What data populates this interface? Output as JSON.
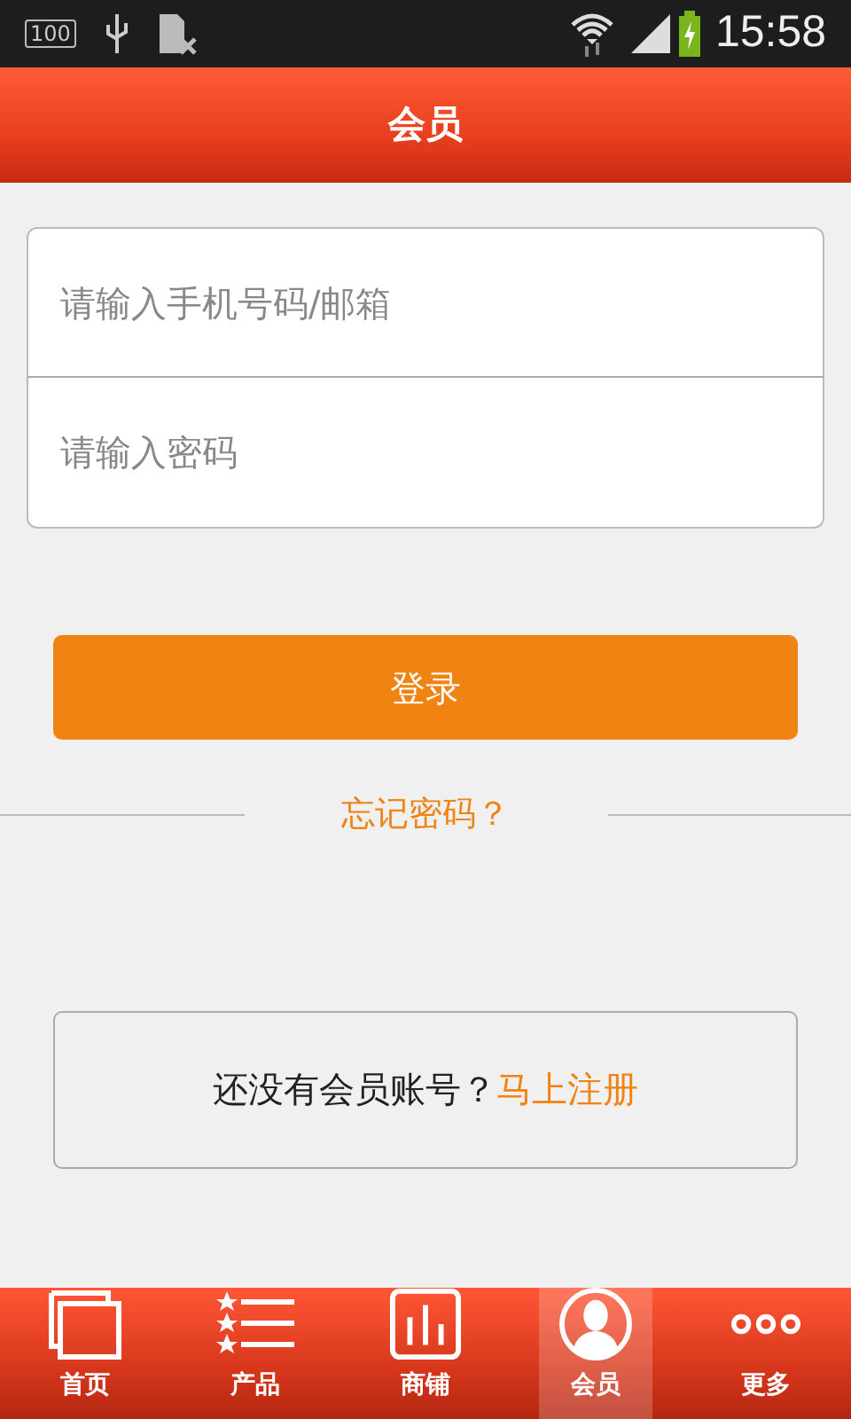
{
  "status_bar": {
    "battery_badge": "100",
    "time": "15:58"
  },
  "header": {
    "title": "会员"
  },
  "form": {
    "fields": [
      {
        "placeholder": "请输入手机号码/邮箱"
      },
      {
        "placeholder": "请输入密码"
      }
    ],
    "login_button": "登录",
    "forgot_link": "忘记密码？"
  },
  "register": {
    "prompt": "还没有会员账号？",
    "link": "马上注册"
  },
  "tabs": [
    {
      "label": "首页",
      "selected": false
    },
    {
      "label": "产品",
      "selected": false
    },
    {
      "label": "商铺",
      "selected": false
    },
    {
      "label": "会员",
      "selected": true
    },
    {
      "label": "更多",
      "selected": false
    }
  ]
}
